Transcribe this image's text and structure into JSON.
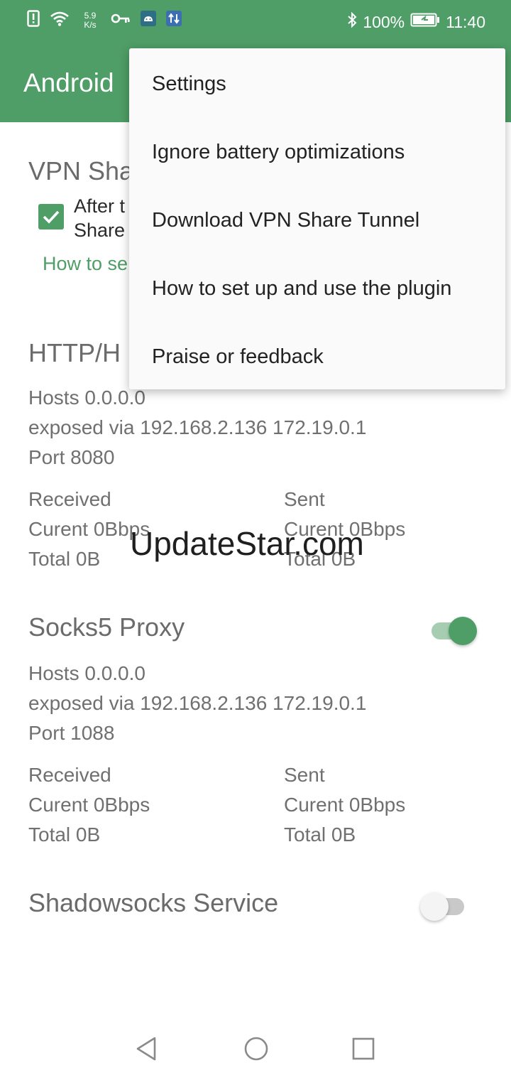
{
  "status_bar": {
    "net_speed_value": "5.9",
    "net_speed_unit": "K/s",
    "battery": "100%",
    "time": "11:40"
  },
  "app_bar": {
    "title": "Android"
  },
  "vpn_section": {
    "title_partial": "VPN Sha",
    "checkbox_line1": "After t",
    "checkbox_line2": "Share",
    "link_partial": "How to se",
    "checked": true
  },
  "http_section": {
    "title_partial": "HTTP/H",
    "hosts": "Hosts 0.0.0.0",
    "exposed": "exposed via 192.168.2.136 172.19.0.1",
    "port": "Port 8080",
    "received_label": "Received",
    "received_current": "Curent 0Bbps",
    "received_total": "Total 0B",
    "sent_label": "Sent",
    "sent_current": "Curent 0Bbps",
    "sent_total": "Total 0B"
  },
  "socks_section": {
    "title": "Socks5 Proxy",
    "enabled": true,
    "hosts": "Hosts 0.0.0.0",
    "exposed": "exposed via 192.168.2.136 172.19.0.1",
    "port": "Port 1088",
    "received_label": "Received",
    "received_current": "Curent 0Bbps",
    "received_total": "Total 0B",
    "sent_label": "Sent",
    "sent_current": "Curent 0Bbps",
    "sent_total": "Total 0B"
  },
  "shadowsocks_section": {
    "title": "Shadowsocks Service",
    "enabled": false
  },
  "menu": {
    "items": [
      {
        "label": "Settings"
      },
      {
        "label": "Ignore battery optimizations"
      },
      {
        "label": "Download VPN Share Tunnel"
      },
      {
        "label": "How to set up and use the plugin"
      },
      {
        "label": "Praise or feedback"
      }
    ]
  },
  "watermark": "UpdateStar.com",
  "colors": {
    "primary": "#4f9d67",
    "text": "#6e6e6e",
    "menu_bg": "#fafafa"
  },
  "icons": {
    "status": [
      "alert-icon",
      "wifi-icon",
      "vpn-key-icon",
      "android-icon",
      "data-transfer-icon",
      "bluetooth-icon",
      "battery-icon"
    ],
    "nav": [
      "back-icon",
      "home-icon",
      "recents-icon"
    ]
  }
}
